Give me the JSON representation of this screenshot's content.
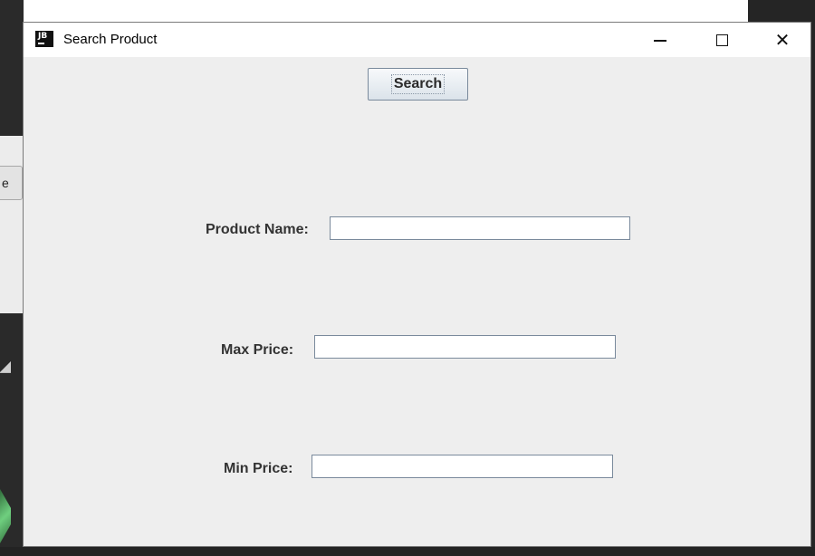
{
  "window": {
    "title": "Search Product",
    "app_icon_text": "JB",
    "icon": "jetbrains-app-icon"
  },
  "controls": {
    "minimize_icon": "minimize-icon",
    "maximize_icon": "maximize-icon",
    "close_icon": "close-icon",
    "close_glyph": "✕"
  },
  "form": {
    "search_label": "Search",
    "product_name_label": "Product Name:",
    "product_name_value": "",
    "max_price_label": "Max Price:",
    "max_price_value": "",
    "min_price_label": "Min Price:",
    "min_price_value": ""
  },
  "background": {
    "left_tab_text": "e"
  }
}
